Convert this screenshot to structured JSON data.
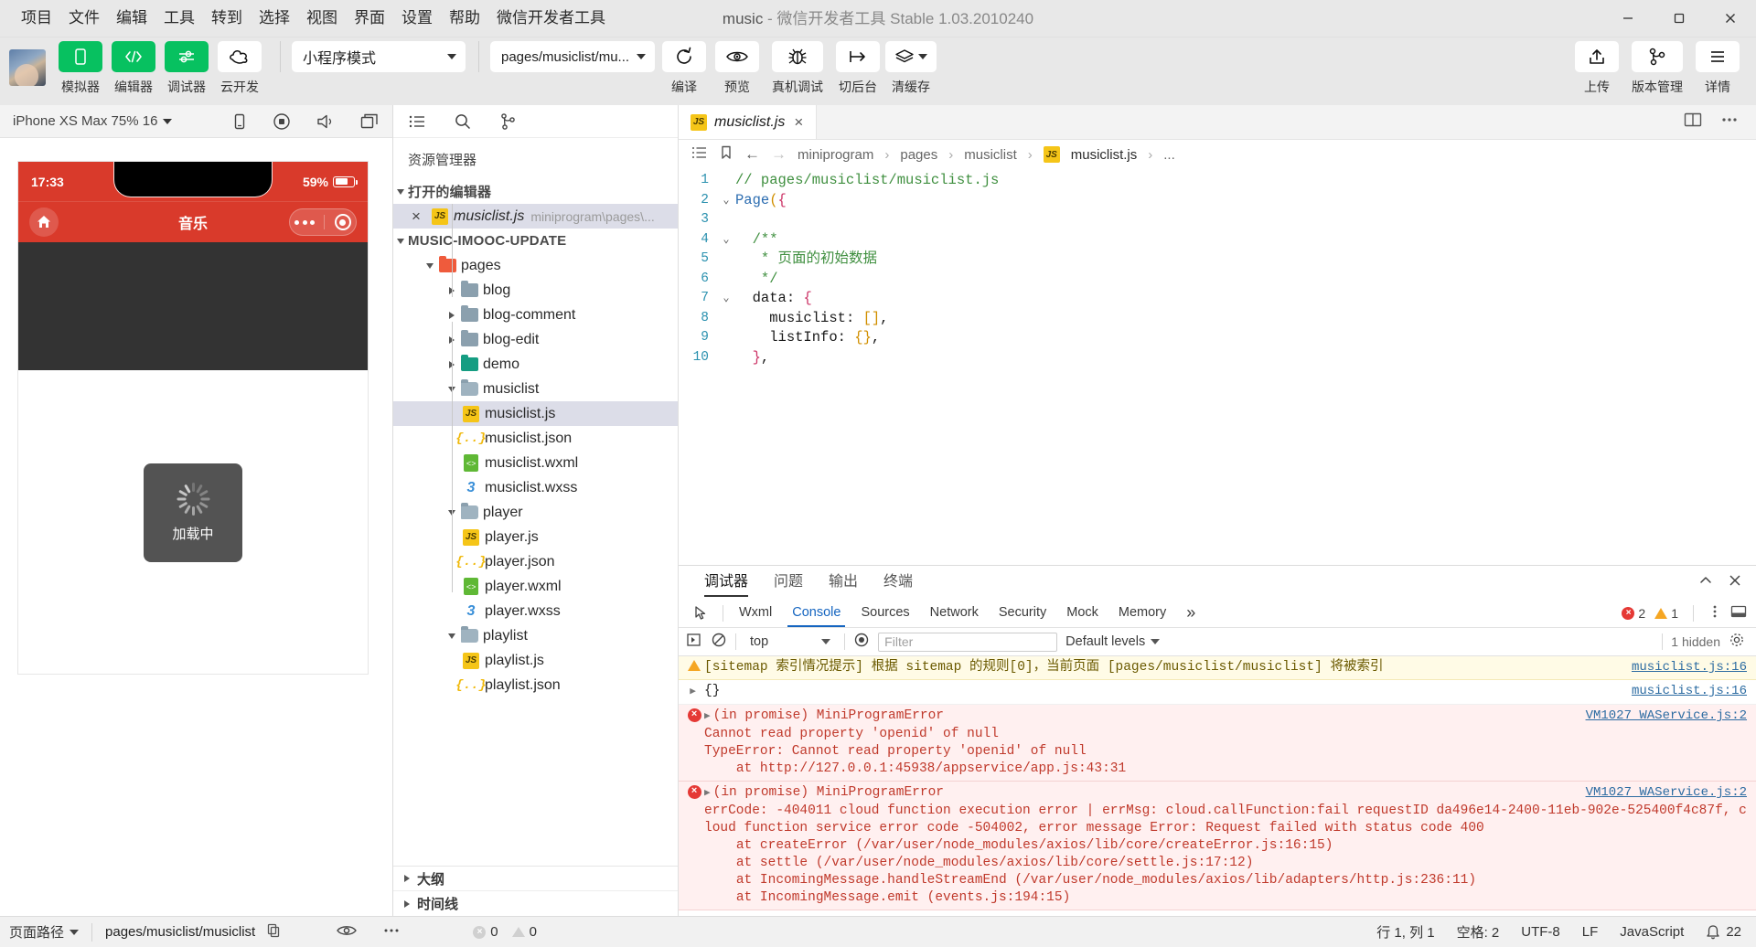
{
  "window": {
    "title_app": "music",
    "title_rest": " - 微信开发者工具 Stable 1.03.2010240",
    "menu": [
      "项目",
      "文件",
      "编辑",
      "工具",
      "转到",
      "选择",
      "视图",
      "界面",
      "设置",
      "帮助",
      "微信开发者工具"
    ]
  },
  "toolbar": {
    "buttons": [
      {
        "label": "模拟器",
        "icon": "phone-icon"
      },
      {
        "label": "编辑器",
        "icon": "code-icon"
      },
      {
        "label": "调试器",
        "icon": "sliders-icon"
      },
      {
        "label": "云开发",
        "icon": "cloud-icon"
      }
    ],
    "mode_select": "小程序模式",
    "page_select": "pages/musiclist/mu...",
    "actions": [
      {
        "label": "编译",
        "icon": "refresh-icon"
      },
      {
        "label": "预览",
        "icon": "eye-icon"
      },
      {
        "label": "真机调试",
        "icon": "bug-icon"
      },
      {
        "label": "切后台",
        "icon": "background-icon"
      },
      {
        "label": "清缓存",
        "icon": "layers-icon"
      }
    ],
    "right_actions": [
      {
        "label": "上传",
        "icon": "upload-icon"
      },
      {
        "label": "版本管理",
        "icon": "branch-icon"
      },
      {
        "label": "详情",
        "icon": "menu-icon"
      }
    ]
  },
  "simulator": {
    "device": "iPhone XS Max 75% 16",
    "icons": [
      "rotate-icon",
      "record-icon",
      "sound-icon",
      "window-icon"
    ],
    "phone": {
      "time": "17:33",
      "battery": "59%",
      "nav_title": "音乐",
      "home_icon": "home-icon",
      "toast_text": "加载中"
    }
  },
  "explorer": {
    "actions": [
      "list-icon",
      "search-icon",
      "branch-icon"
    ],
    "title": "资源管理器",
    "collapse_icon": "collapse-sidebar-icon",
    "open_editors": {
      "label": "打开的编辑器",
      "items": [
        {
          "name": "musiclist.js",
          "sub": "miniprogram\\pages\\...",
          "icon": "js-icon",
          "selected": true
        }
      ]
    },
    "project": {
      "label": "MUSIC-IMOOC-UPDATE",
      "tree": [
        {
          "depth": 1,
          "name": "pages",
          "kind": "folder-pages",
          "state": "open"
        },
        {
          "depth": 2,
          "name": "blog",
          "kind": "folder",
          "state": "closed"
        },
        {
          "depth": 2,
          "name": "blog-comment",
          "kind": "folder",
          "state": "closed"
        },
        {
          "depth": 2,
          "name": "blog-edit",
          "kind": "folder",
          "state": "closed"
        },
        {
          "depth": 2,
          "name": "demo",
          "kind": "folder-demo",
          "state": "closed"
        },
        {
          "depth": 2,
          "name": "musiclist",
          "kind": "folder",
          "state": "open"
        },
        {
          "depth": 3,
          "name": "musiclist.js",
          "kind": "js",
          "selected": true
        },
        {
          "depth": 3,
          "name": "musiclist.json",
          "kind": "json"
        },
        {
          "depth": 3,
          "name": "musiclist.wxml",
          "kind": "wxml"
        },
        {
          "depth": 3,
          "name": "musiclist.wxss",
          "kind": "wxss"
        },
        {
          "depth": 2,
          "name": "player",
          "kind": "folder",
          "state": "open"
        },
        {
          "depth": 3,
          "name": "player.js",
          "kind": "js"
        },
        {
          "depth": 3,
          "name": "player.json",
          "kind": "json"
        },
        {
          "depth": 3,
          "name": "player.wxml",
          "kind": "wxml"
        },
        {
          "depth": 3,
          "name": "player.wxss",
          "kind": "wxss"
        },
        {
          "depth": 2,
          "name": "playlist",
          "kind": "folder",
          "state": "open"
        },
        {
          "depth": 3,
          "name": "playlist.js",
          "kind": "js"
        },
        {
          "depth": 3,
          "name": "playlist.json",
          "kind": "json"
        }
      ]
    },
    "bottom_panes": [
      "大纲",
      "时间线"
    ]
  },
  "editor": {
    "tab": {
      "name": "musiclist.js",
      "icon": "js-icon",
      "close": "×"
    },
    "tab_right_icons": [
      "split-editor-icon",
      "more-icon"
    ],
    "breadcrumb": [
      "miniprogram",
      "pages",
      "musiclist",
      "musiclist.js",
      "..."
    ],
    "bread_icons": [
      "outline-icon",
      "bookmark-icon",
      "back-arrow-icon",
      "forward-arrow-icon"
    ],
    "lines": [
      {
        "no": "1",
        "fold": "",
        "html": "<span class='k-com'>// pages/musiclist/musiclist.js</span>"
      },
      {
        "no": "2",
        "fold": "v",
        "html": "<span class='k-fn'>Page</span><span class='k-br'>(</span><span class='k-pu'>{</span>"
      },
      {
        "no": "3",
        "fold": "",
        "html": ""
      },
      {
        "no": "4",
        "fold": "v",
        "html": "  <span class='k-com'>/**</span>"
      },
      {
        "no": "5",
        "fold": "",
        "html": "   <span class='k-com'>* 页面的初始数据</span>"
      },
      {
        "no": "6",
        "fold": "",
        "html": "   <span class='k-com'>*/</span>"
      },
      {
        "no": "7",
        "fold": "v",
        "html": "  <span class='k-key'>data</span><span class='k-id'>:</span> <span class='k-pu'>{</span>"
      },
      {
        "no": "8",
        "fold": "",
        "html": "    <span class='k-key'>musiclist</span><span class='k-id'>:</span> <span class='k-br'>[]</span><span class='k-id'>,</span>"
      },
      {
        "no": "9",
        "fold": "",
        "html": "    <span class='k-key'>listInfo</span><span class='k-id'>:</span> <span class='k-br'>{}</span><span class='k-id'>,</span>"
      },
      {
        "no": "10",
        "fold": "",
        "html": "  <span class='k-pu'>}</span><span class='k-id'>,</span>"
      }
    ]
  },
  "console": {
    "panel_tabs": [
      "调试器",
      "问题",
      "输出",
      "终端"
    ],
    "panel_active": "调试器",
    "panel_right_icons": [
      "chevron-up-icon",
      "close-icon"
    ],
    "devtools_tabs": [
      "Wxml",
      "Console",
      "Sources",
      "Network",
      "Security",
      "Mock",
      "Memory"
    ],
    "devtools_active": "Console",
    "devtools_more": "»",
    "inspect_icon": "inspect-icon",
    "error_count": "2",
    "warning_count": "1",
    "kebab_icon": "kebab-icon",
    "dock_icon": "dock-icon",
    "filter_row": {
      "execute_icon": "execute-icon",
      "clear_icon": "clear-console-icon",
      "context": "top",
      "eye_icon": "live-expression-icon",
      "filter_placeholder": "Filter",
      "levels": "Default levels",
      "hidden": "1 hidden",
      "settings_icon": "settings-icon"
    },
    "messages": [
      {
        "type": "warn",
        "icon": "warning-icon",
        "text": "[sitemap 索引情况提示] 根据 sitemap 的规则[0]，当前页面 [pages/musiclist/musiclist] 将被索引",
        "source": "musiclist.js:16"
      },
      {
        "type": "plain",
        "icon": "expand-icon",
        "text": "{}",
        "source": ""
      },
      {
        "type": "err",
        "icon": "error-icon",
        "text": "(in promise) MiniProgramError\nCannot read property 'openid' of null\nTypeError: Cannot read property 'openid' of null\n    at http://127.0.0.1:45938/appservice/app.js:43:31",
        "source": "VM1027 WAService.js:2"
      },
      {
        "type": "err",
        "icon": "error-icon",
        "text": "(in promise) MiniProgramError\nerrCode: -404011 cloud function execution error | errMsg: cloud.callFunction:fail requestID da496e14-2400-11eb-902e-525400f4c87f, cloud function service error code -504002, error message Error: Request failed with status code 400\n    at createError (/var/user/node_modules/axios/lib/core/createError.js:16:15)\n    at settle (/var/user/node_modules/axios/lib/core/settle.js:17:12)\n    at IncomingMessage.handleStreamEnd (/var/user/node_modules/axios/lib/adapters/http.js:236:11)\n    at IncomingMessage.emit (events.js:194:15)",
        "source": "VM1027 WAService.js:2"
      }
    ]
  },
  "statusbar": {
    "page_path_label": "页面路径",
    "page_path": "pages/musiclist/musiclist",
    "copy_icon": "copy-icon",
    "eye_icon": "eye-icon",
    "more_icon": "more-icon",
    "problems_errors": "0",
    "problems_warnings": "0",
    "cursor": "行 1, 列 1",
    "spaces": "空格: 2",
    "encoding": "UTF-8",
    "eol": "LF",
    "language": "JavaScript",
    "notif_count": "22",
    "bell_icon": "bell-icon"
  },
  "colors": {
    "brand_green": "#07c160",
    "phone_red": "#d93a2b",
    "error_red": "#e53935",
    "warn_yellow": "#f5a623",
    "link_blue": "#2d6ca2"
  }
}
